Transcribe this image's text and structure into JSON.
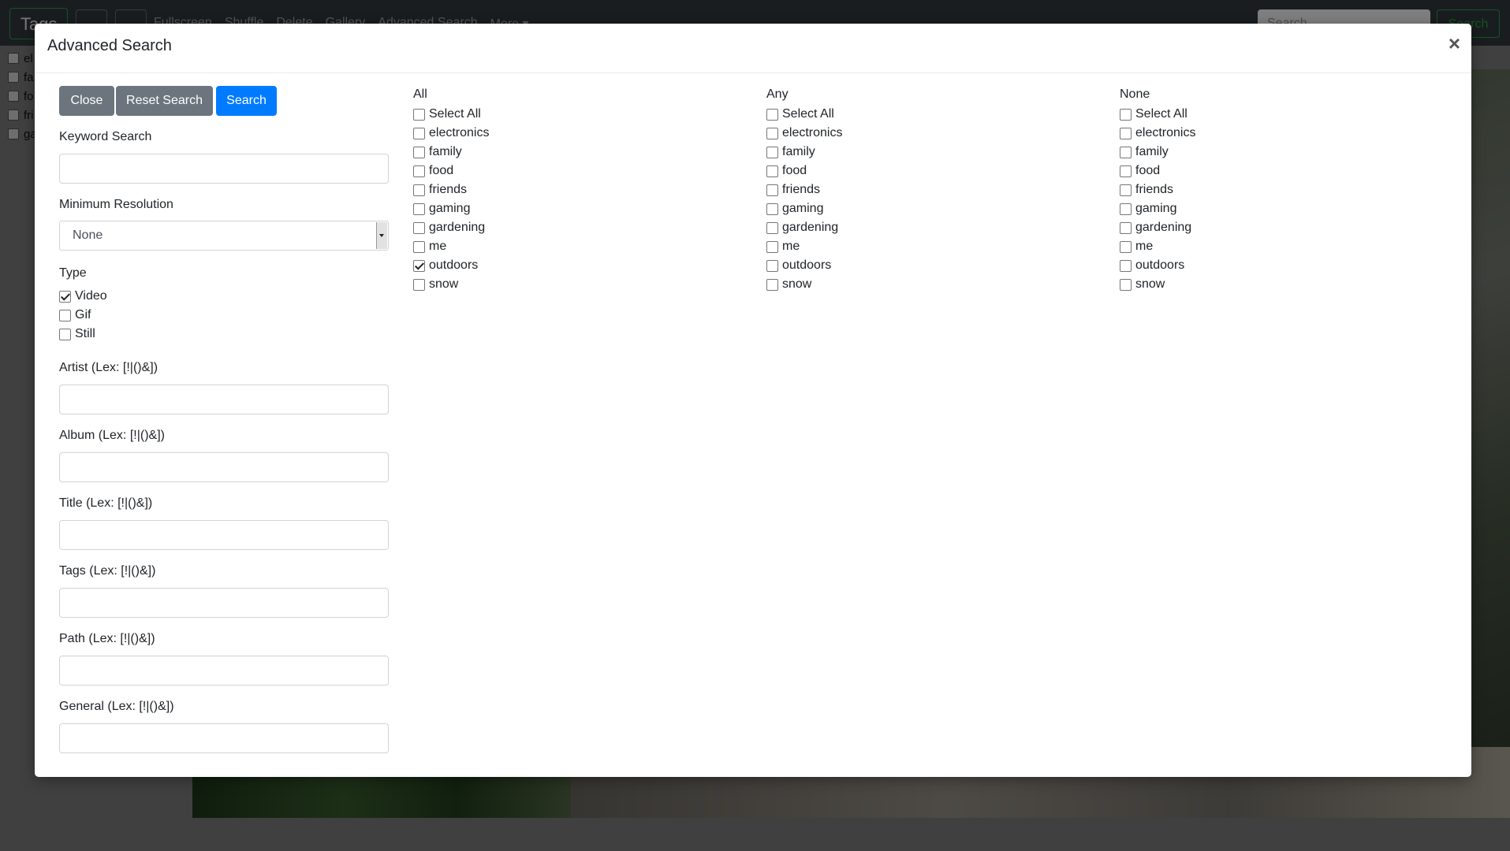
{
  "navbar": {
    "brand": "Tags",
    "links": [
      "Fullscreen",
      "Shuffle",
      "Delete",
      "Gallery",
      "Advanced Search",
      "More ▾"
    ],
    "search_placeholder": "Search",
    "search_button": "Search"
  },
  "sidebar_tags": [
    "el",
    "fa",
    "fo",
    "fri",
    "ga"
  ],
  "modal": {
    "title": "Advanced Search",
    "close_glyph": "×",
    "buttons": {
      "close": "Close",
      "reset": "Reset Search",
      "search": "Search"
    },
    "keyword_label": "Keyword Search",
    "keyword_value": "",
    "min_res_label": "Minimum Resolution",
    "min_res_value": "None",
    "type_label": "Type",
    "types": [
      {
        "label": "Video",
        "checked": true
      },
      {
        "label": "Gif",
        "checked": false
      },
      {
        "label": "Still",
        "checked": false
      }
    ],
    "fields": {
      "artist": "Artist (Lex: [!|()&])",
      "album": "Album (Lex: [!|()&])",
      "title": "Title (Lex: [!|()&])",
      "tags": "Tags (Lex: [!|()&])",
      "path": "Path (Lex: [!|()&])",
      "general": "General (Lex: [!|()&])"
    },
    "columns": [
      {
        "heading": "All",
        "checked": [
          "outdoors"
        ]
      },
      {
        "heading": "Any",
        "checked": []
      },
      {
        "heading": "None",
        "checked": []
      }
    ],
    "tag_options": [
      "Select All",
      "electronics",
      "family",
      "food",
      "friends",
      "gaming",
      "gardening",
      "me",
      "outdoors",
      "snow"
    ]
  }
}
